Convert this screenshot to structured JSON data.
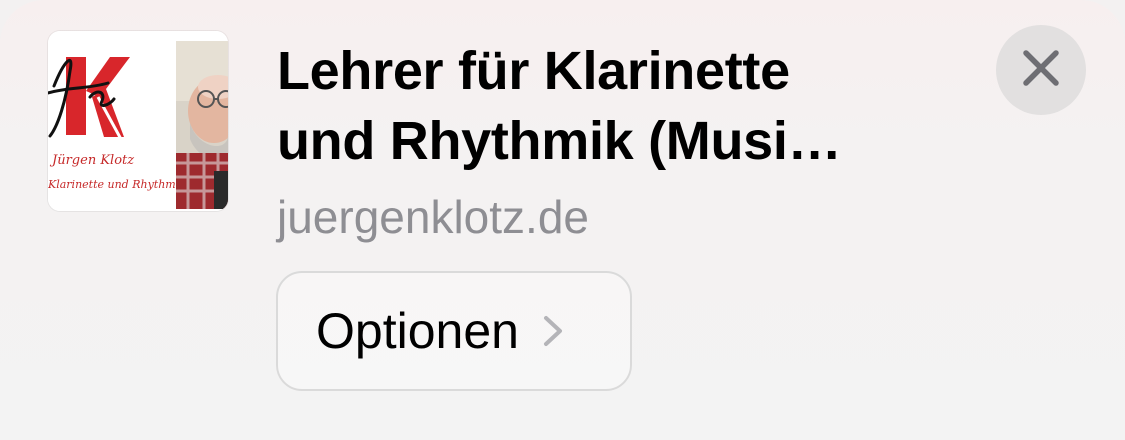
{
  "card": {
    "thumbnail": {
      "logo_letter": "K",
      "caption_line1": "Jürgen Klotz",
      "caption_line2": "Klarinette und Rhythmik"
    },
    "title_line1": "Lehrer für Klarinette",
    "title_line2": "und Rhythmik (Musi…",
    "domain": "juergenklotz.de",
    "options_label": "Optionen",
    "options_icon": "chevron-right-icon",
    "close_icon": "close-icon"
  },
  "colors": {
    "logo_red": "#d8262b",
    "title": "#000000",
    "domain": "#8e8e93",
    "close_bg": "#e2e0e0",
    "close_glyph": "#6e6e73"
  }
}
